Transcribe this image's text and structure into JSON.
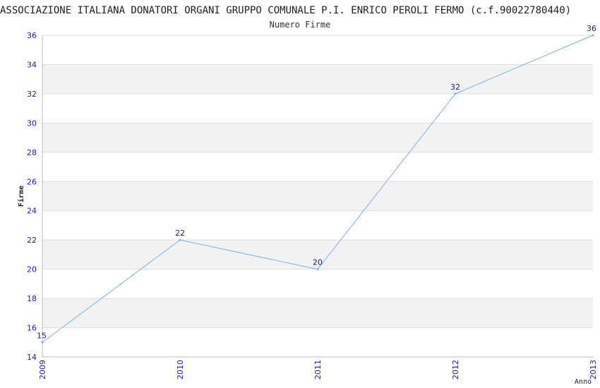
{
  "chart_data": {
    "type": "line",
    "title": "ASSOCIAZIONE ITALIANA DONATORI ORGANI GRUPPO COMUNALE P.I. ENRICO PEROLI FERMO (c.f.90022780440)",
    "subtitle": "Numero Firme",
    "xlabel": "Anno",
    "ylabel": "Firme",
    "categories": [
      "2009",
      "2010",
      "2011",
      "2012",
      "2013"
    ],
    "series": [
      {
        "values": [
          15,
          22,
          20,
          32,
          36
        ]
      }
    ],
    "ylim": [
      14,
      36
    ],
    "yticks": [
      14,
      16,
      18,
      20,
      22,
      24,
      26,
      28,
      30,
      32,
      34,
      36
    ],
    "grid": true,
    "colors": {
      "line": "#7ab0e8",
      "band": "#f2f2f2",
      "grid": "#dddddd",
      "tick": "#1a1acc",
      "data_label": "#1a1a80"
    }
  }
}
